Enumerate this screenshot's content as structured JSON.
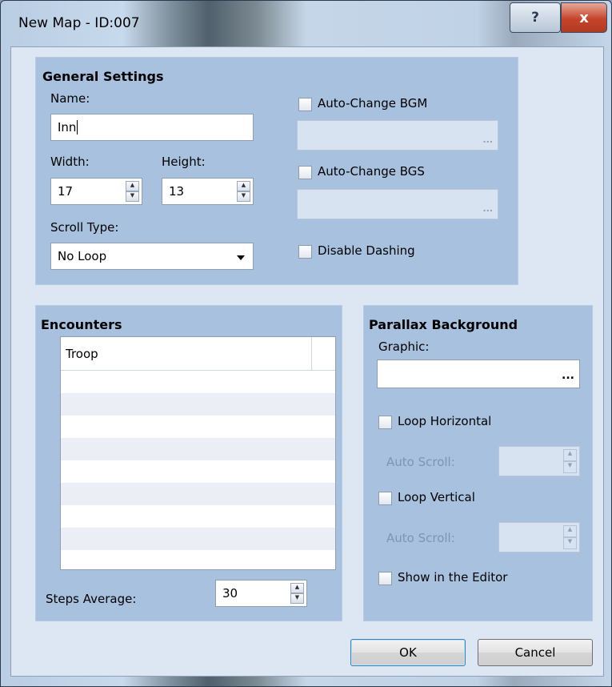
{
  "window": {
    "title": "New Map - ID:007",
    "help_label": "?",
    "close_label": "x"
  },
  "general": {
    "title": "General Settings",
    "name_label": "Name:",
    "name_value": "Inn",
    "width_label": "Width:",
    "width_value": "17",
    "height_label": "Height:",
    "height_value": "13",
    "scroll_label": "Scroll Type:",
    "scroll_value": "No Loop",
    "bgm_label": "Auto-Change BGM",
    "bgs_label": "Auto-Change BGS",
    "dash_label": "Disable Dashing",
    "ellipsis": "..."
  },
  "encounters": {
    "title": "Encounters",
    "column_header": "Troop",
    "rows": [
      "",
      "",
      "",
      "",
      "",
      "",
      "",
      "",
      ""
    ],
    "steps_label": "Steps Average:",
    "steps_value": "30"
  },
  "parallax": {
    "title": "Parallax Background",
    "graphic_label": "Graphic:",
    "graphic_value": "",
    "ellipsis": "...",
    "loop_h_label": "Loop Horizontal",
    "auto_scroll_h_label": "Auto Scroll:",
    "loop_v_label": "Loop Vertical",
    "auto_scroll_v_label": "Auto Scroll:",
    "show_editor_label": "Show in the Editor"
  },
  "buttons": {
    "ok": "OK",
    "cancel": "Cancel"
  },
  "icons": {
    "spin_up": "▲",
    "spin_down": "▼"
  },
  "colors": {
    "group_bg": "#a7c1de",
    "client_bg": "#dde6f3",
    "disabled_text": "#7e95b2"
  }
}
